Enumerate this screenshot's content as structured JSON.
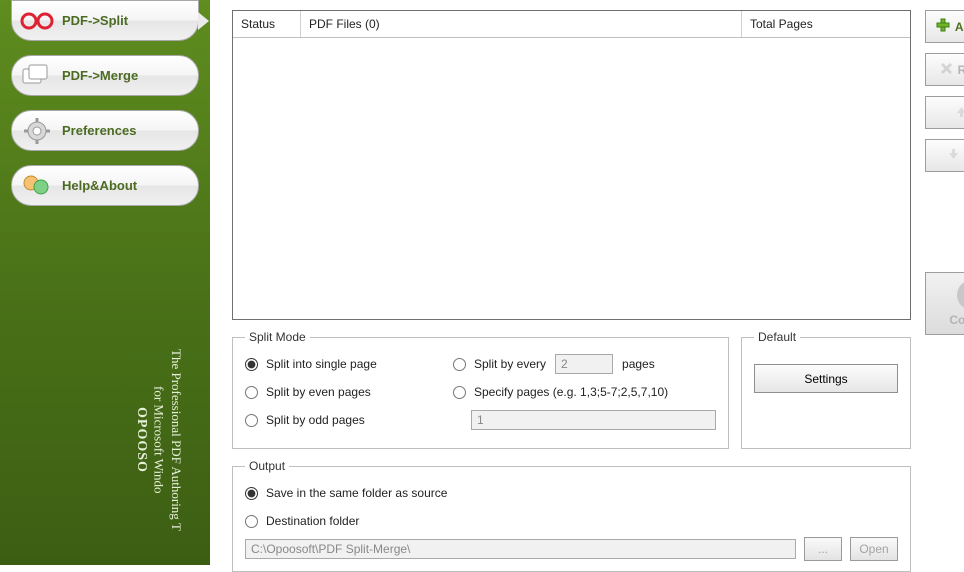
{
  "sidebar": {
    "items": [
      {
        "label": "PDF->Split"
      },
      {
        "label": "PDF->Merge"
      },
      {
        "label": "Preferences"
      },
      {
        "label": "Help&About"
      }
    ],
    "brand": "OPOOSO",
    "tagline1": "The Professional PDF Authoring T",
    "tagline2": "for Microsoft Windo"
  },
  "table": {
    "status_header": "Status",
    "files_header": "PDF Files (0)",
    "pages_header": "Total Pages"
  },
  "buttons": {
    "add": "Add",
    "more": "...",
    "remove": "Remove",
    "up": "Up",
    "down": "Down",
    "convert": "Convert",
    "settings": "Settings",
    "browse": "...",
    "open": "Open"
  },
  "split": {
    "legend": "Split Mode",
    "single": "Split into single page",
    "even": "Split by even pages",
    "odd": "Split by odd pages",
    "every_pre": "Split by every",
    "every_val": "2",
    "every_post": "pages",
    "specify": "Specify pages (e.g. 1,3;5-7;2,5,7,10)",
    "specify_val": "1"
  },
  "default": {
    "legend": "Default"
  },
  "output": {
    "legend": "Output",
    "same": "Save in the same folder as source",
    "dest": "Destination folder",
    "path": "C:\\Opoosoft\\PDF Split-Merge\\"
  }
}
